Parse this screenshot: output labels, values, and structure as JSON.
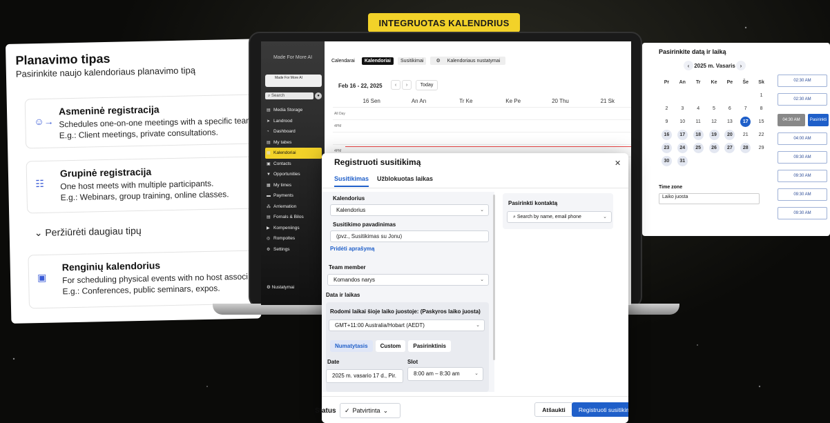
{
  "badge": "INTEGRUOTAS KALENDRIUS",
  "left_card": {
    "title": "Planavimo tipas",
    "subtitle": "Pasirinkite naujo kalendoriaus planavimo tipą",
    "options": [
      {
        "name": "Asmeninė registracija",
        "desc": "Schedules one-on-one meetings with a specific team",
        "example": "E.g.: Client meetings, private consultations."
      },
      {
        "name": "Grupinė registracija",
        "desc": "One host meets with multiple participants.",
        "example": "E.g.: Webinars, group training, online classes."
      },
      {
        "name": "Renginių kalendorius",
        "desc": "For scheduling physical events with no host associ",
        "example": "E.g.: Conferences, public seminars, expos."
      }
    ],
    "more": "Peržiūrėti daugiau tipų"
  },
  "right_card": {
    "title": "Pasirinkite datą ir laiką",
    "month": "2025 m. Vasaris",
    "weekdays": [
      "Pr",
      "An",
      "Tr",
      "Ke",
      "Pe",
      "Še",
      "Sk"
    ],
    "weeks": [
      [
        "",
        "",
        "",
        "",
        "",
        "",
        "1"
      ],
      [
        "2",
        "3",
        "4",
        "5",
        "6",
        "7",
        "8"
      ],
      [
        "9",
        "10",
        "11",
        "12",
        "13",
        "17",
        "15"
      ],
      [
        "16",
        "17",
        "18",
        "19",
        "20",
        "21",
        "22"
      ],
      [
        "23",
        "24",
        "25",
        "26",
        "27",
        "28",
        "29"
      ],
      [
        "30",
        "31",
        "",
        "",
        "",
        "",
        ""
      ]
    ],
    "slots": [
      "02:30 AM",
      "02:30 AM",
      "04:30 AM",
      "04:00 AM",
      "09:30 AM",
      "09:30 AM",
      "09:30 AM",
      "09:30 AM"
    ],
    "confirm": "Pasirinkti",
    "timezone_label": "Time zone",
    "timezone_value": "Laiko juosta"
  },
  "sidebar": {
    "brand": "Made For More AI",
    "account": "Made For More AI",
    "search": "Search",
    "items": [
      "Media Storage",
      "Landrood",
      "Dashboard",
      "My tabes",
      "Kalendoriai",
      "Contacts",
      "Opportunities",
      "My times",
      "Payments",
      "Arriemation",
      "Fornals & Bilos",
      "Kompeniings",
      "Rompoltes",
      "Settings"
    ],
    "bottom": "Nustatymai"
  },
  "app": {
    "tabs": [
      "Calendarai",
      "Kalendoriai",
      "Susitikimai",
      "Kalendoriaus nustatymai"
    ],
    "week": "Feb 16 - 22, 2025",
    "today": "Today",
    "days": [
      "16 Sen",
      "An An",
      "Tr Ke",
      "Ke Pe",
      "20 Thu",
      "21 Sk"
    ],
    "rows": [
      "All Day",
      "4PM",
      "4PM"
    ]
  },
  "modal": {
    "title": "Registruoti susitikimą",
    "tabs": [
      "Susitikimas",
      "Užblokuotas laikas"
    ],
    "calendar_label": "Kalendorius",
    "calendar_value": "Kalendorius",
    "name_label": "Susitikimo pavadinimas",
    "name_value": "(pvz., Susitikimas su Jonu)",
    "add_desc": "Pridėti aprašymą",
    "team_label": "Team member",
    "team_value": "Komandos narys",
    "datetime_label": "Data ir laikas",
    "tz_label": "Rodomi laikai šioje laiko juostoje: (Paskyros laiko juosta)",
    "tz_value": "GMT+11:00 Australia/Hobart (AEDT)",
    "pills": [
      "Numatytasis",
      "Custom",
      "Pasirinktinis"
    ],
    "date_label": "Date",
    "date_value": "2025 m. vasario 17 d., Pir.",
    "slot_label": "Slot",
    "slot_value": "8:00 am – 8:30 am",
    "contact_label": "Pasirinkti kontaktą",
    "contact_placeholder": "Search by name, email phone",
    "status_label": "Status",
    "status_value": "Patvirtinta",
    "cancel": "Atšaukti",
    "submit": "Registruoti susitikimą"
  }
}
